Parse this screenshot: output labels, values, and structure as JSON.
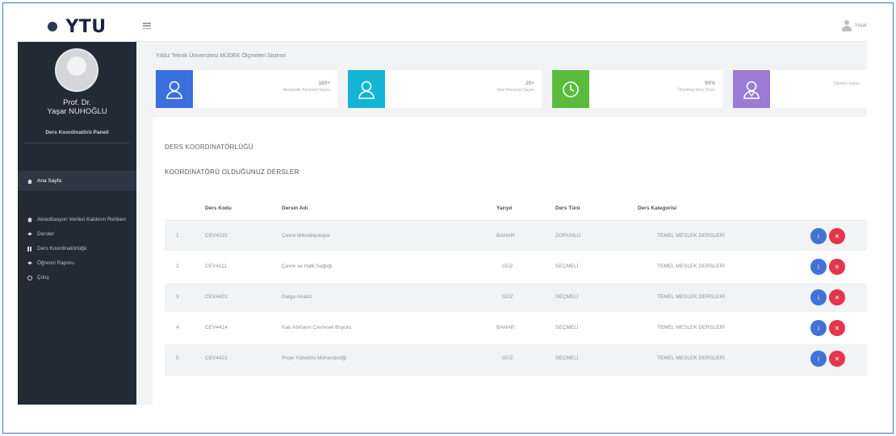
{
  "app": {
    "logo_text": "YTU",
    "user_name": "Yaşar"
  },
  "sidebar": {
    "profile_title": "Prof. Dr.",
    "profile_name": "Yaşar NUHOĞLU",
    "role": "Ders Koordinatörü Paneli",
    "active_item": "Ana Sayfa",
    "items": [
      {
        "label": "Akreditasyon Verileri Kaldırım Rehberi",
        "icon": "home-icon"
      },
      {
        "label": "Dersler",
        "icon": "graduation-cap-icon"
      },
      {
        "label": "Ders Koordinatörlüğü",
        "icon": "grid-icon"
      },
      {
        "label": "Öğrenci Raporu",
        "icon": "graduation-cap-icon"
      },
      {
        "label": "Çıkış",
        "icon": "power-icon"
      }
    ]
  },
  "breadcrumb": "Yıldız Teknik Üniversitesi MÜDEK Ölçmeleri Sistemi",
  "stats": [
    {
      "value": "180+",
      "label": "Akademik Personel Sayısı",
      "color": "#3a6fdc",
      "icon": "user-icon"
    },
    {
      "value": "20+",
      "label": "İdari Personel Sayısı",
      "color": "#13b4d4",
      "icon": "user-icon"
    },
    {
      "value": "90%",
      "label": "Ölçülmüş Ders Oranı",
      "color": "#5bbb3c",
      "icon": "clock-icon"
    },
    {
      "value": "",
      "label": "Öğrenci Sayısı",
      "color": "#9b7bd6",
      "icon": "student-icon"
    }
  ],
  "card": {
    "title": "DERS KOORDİNATÖRLÜĞÜ",
    "subtitle": "KOORDİNATÖRÜ OLDUĞUNUZ DERSLER"
  },
  "table": {
    "headers": [
      "Ders Kodu",
      "Dersin Adı",
      "Yarıyıl",
      "Ders Türü",
      "Ders Kategorisi"
    ],
    "rows": [
      {
        "no": "1",
        "code": "CEV4231",
        "name": "Çevre Mikrobiyolojisi",
        "term": "BAHAR",
        "type": "ZORUNLU",
        "category": "TEMEL MESLEK DERSLERİ"
      },
      {
        "no": "2",
        "code": "CEV4111",
        "name": "Çevre ve Halk Sağlığı",
        "term": "GÜZ",
        "type": "SEÇMELİ",
        "category": "TEMEL MESLEK DERSLERİ"
      },
      {
        "no": "3",
        "code": "CEV4401",
        "name": "Dalga Analizi",
        "term": "GÜZ",
        "type": "SEÇMELİ",
        "category": "TEMEL MESLEK DERSLERİ"
      },
      {
        "no": "4",
        "code": "CEV4414",
        "name": "Katı Atıkların Çevresel Boyutu",
        "term": "BAHAR",
        "type": "SEÇMELİ",
        "category": "TEMEL MESLEK DERSLERİ"
      },
      {
        "no": "5",
        "code": "CEV4421",
        "name": "Proje Yönetimi Mühendisliği",
        "term": "GÜZ",
        "type": "SEÇMELİ",
        "category": "TEMEL MESLEK DERSLERİ"
      }
    ],
    "info_label": "i",
    "delete_label": "✕"
  }
}
